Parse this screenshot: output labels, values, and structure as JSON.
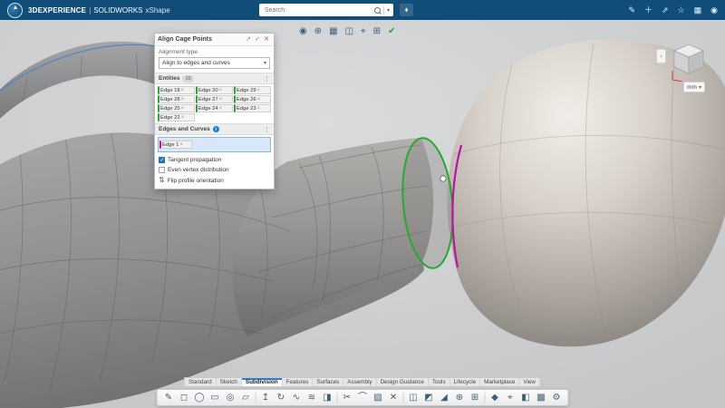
{
  "topbar": {
    "brand": {
      "name_bold": "3DEXPERIENCE",
      "divider": "|",
      "name_secondary": "SOLIDWORKS",
      "app": "xShape"
    },
    "search": {
      "placeholder": "Search"
    },
    "right_icons": [
      {
        "name": "edit-icon",
        "glyph": "✎"
      },
      {
        "name": "add-icon",
        "glyph": "＋"
      },
      {
        "name": "share-icon",
        "glyph": "⇗"
      },
      {
        "name": "favorites-icon",
        "glyph": "☆"
      },
      {
        "name": "apps-icon",
        "glyph": "▦"
      },
      {
        "name": "user-icon",
        "glyph": "◉"
      }
    ]
  },
  "quickbar": {
    "icons": [
      {
        "name": "visibility-icon",
        "glyph": "◉"
      },
      {
        "name": "render-style-icon",
        "glyph": "⊕"
      },
      {
        "name": "display-grid-icon",
        "glyph": "▦"
      },
      {
        "name": "section-view-icon",
        "glyph": "◫"
      },
      {
        "name": "view-target-icon",
        "glyph": "⌖"
      },
      {
        "name": "snap-icon",
        "glyph": "⊞"
      },
      {
        "name": "update-icon",
        "glyph": "✔",
        "color": "#2f9e44"
      }
    ]
  },
  "dialog": {
    "title": "Align Cage Points",
    "header_icons": [
      {
        "name": "popout-icon",
        "glyph": "↗",
        "color": "#8a8f94"
      },
      {
        "name": "confirm-button",
        "glyph": "✓",
        "color": "#2f9e44"
      },
      {
        "name": "cancel-button",
        "glyph": "✕",
        "color": "#d64545"
      }
    ],
    "alignment_type_label": "Alignment type",
    "alignment_type_value": "Align to edges and curves",
    "entities_label": "Entities",
    "entities_count": "10",
    "entities_chips": [
      "Edge 18",
      "Edge 20",
      "Edge 29",
      "Edge 28",
      "Edge 27",
      "Edge 26",
      "Edge 25",
      "Edge 24",
      "Edge 23",
      "Edge 22"
    ],
    "edges_curves_label": "Edges and Curves",
    "edges_curves_info": "i",
    "edges_curves_chip": "Edge 1",
    "tangent_label": "Tangent propagation",
    "even_label": "Even vertex distribution",
    "flip_icon": "⇅",
    "flip_label": "Flip profile orientation"
  },
  "viewcube": {
    "chevron": "‹",
    "units": "mm"
  },
  "tabs": {
    "items": [
      {
        "label": "Standard"
      },
      {
        "label": "Sketch"
      },
      {
        "label": "Subdivision",
        "active": true
      },
      {
        "label": "Features"
      },
      {
        "label": "Surfaces"
      },
      {
        "label": "Assembly"
      },
      {
        "label": "Design Guidance"
      },
      {
        "label": "Tools"
      },
      {
        "label": "Lifecycle"
      },
      {
        "label": "Marketplace"
      },
      {
        "label": "View"
      }
    ]
  },
  "toolbar": {
    "icons": [
      {
        "name": "sketch-tool",
        "glyph": "✎"
      },
      {
        "name": "box-primitive-tool",
        "glyph": "◻"
      },
      {
        "name": "sphere-primitive-tool",
        "glyph": "◯"
      },
      {
        "name": "cylinder-primitive-tool",
        "glyph": "▭"
      },
      {
        "name": "torus-primitive-tool",
        "glyph": "◎"
      },
      {
        "name": "plane-primitive-tool",
        "glyph": "▱"
      },
      {
        "sep": true
      },
      {
        "name": "extrude-tool",
        "glyph": "↥"
      },
      {
        "name": "revolve-tool",
        "glyph": "↻"
      },
      {
        "name": "sweep-tool",
        "glyph": "∿"
      },
      {
        "name": "loft-tool",
        "glyph": "≋"
      },
      {
        "name": "thicken-tool",
        "glyph": "◨"
      },
      {
        "sep": true
      },
      {
        "name": "split-face-tool",
        "glyph": "✂"
      },
      {
        "name": "bridge-tool",
        "glyph": "⌒"
      },
      {
        "name": "fill-face-tool",
        "glyph": "▨"
      },
      {
        "name": "delete-face-tool",
        "glyph": "✕"
      },
      {
        "sep": true
      },
      {
        "name": "symmetry-tool",
        "glyph": "◫"
      },
      {
        "name": "mirror-tool",
        "glyph": "◩"
      },
      {
        "name": "crease-edge-tool",
        "glyph": "◢"
      },
      {
        "name": "weld-points-tool",
        "glyph": "⊕"
      },
      {
        "name": "subdivide-tool",
        "glyph": "⊞"
      },
      {
        "sep": true
      },
      {
        "name": "align-points-tool",
        "glyph": "◆"
      },
      {
        "name": "measure-tool",
        "glyph": "⌖"
      },
      {
        "name": "section-tool",
        "glyph": "◧"
      },
      {
        "name": "display-grid-tool",
        "glyph": "▩"
      },
      {
        "name": "settings-tool",
        "glyph": "⚙"
      }
    ]
  },
  "scene": {
    "selection_green": "#27a82e",
    "selection_magenta": "#b5179e",
    "hover_blue": "#3f7fd6"
  }
}
